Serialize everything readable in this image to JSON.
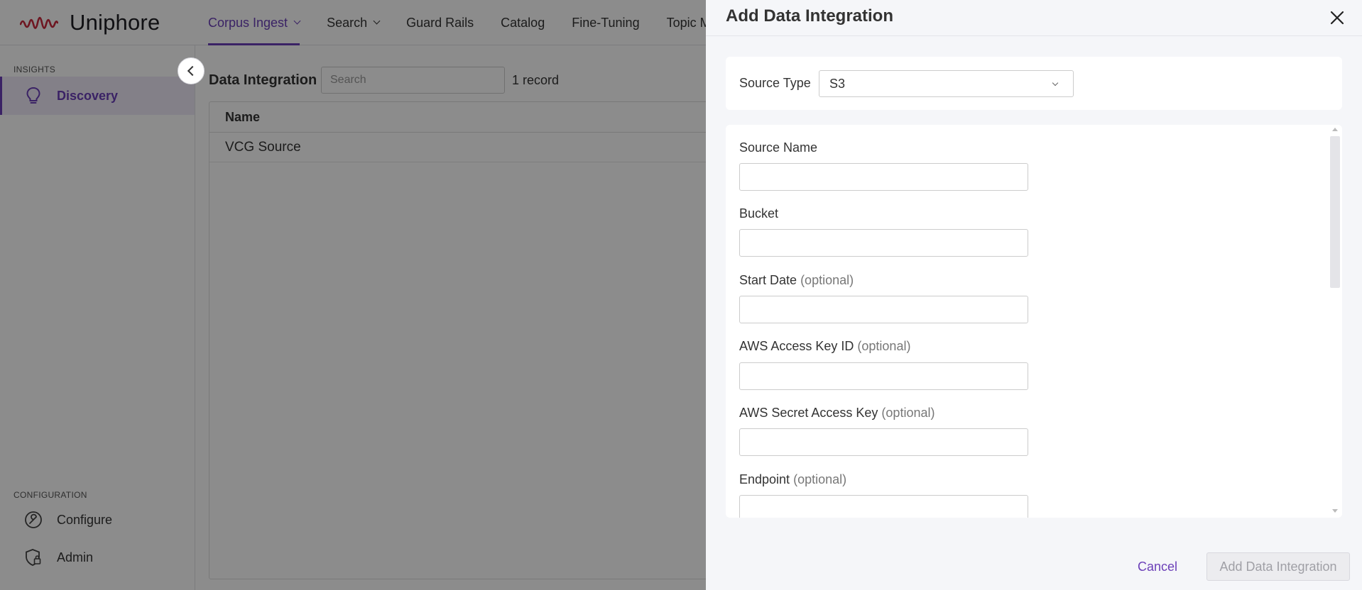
{
  "app": {
    "name": "Uniphore"
  },
  "nav": {
    "items": [
      {
        "label": "Corpus Ingest"
      },
      {
        "label": "Search"
      },
      {
        "label": "Guard Rails"
      },
      {
        "label": "Catalog"
      },
      {
        "label": "Fine-Tuning"
      },
      {
        "label": "Topic M"
      }
    ],
    "active_label": "Corpus Ingest"
  },
  "sidebar": {
    "sections": [
      {
        "label": "INSIGHTS"
      },
      {
        "label": "CONFIGURATION"
      }
    ],
    "items": [
      {
        "label": "Discovery",
        "icon": "lightbulb-icon",
        "active": true
      },
      {
        "label": "Configure",
        "icon": "wrench-icon"
      },
      {
        "label": "Admin",
        "icon": "shield-lock-icon"
      }
    ]
  },
  "main": {
    "title": "Data Integration",
    "search_placeholder": "Search",
    "record_count": "1 record",
    "table": {
      "columns": [
        "Name"
      ],
      "rows": [
        [
          "VCG Source"
        ]
      ]
    }
  },
  "drawer": {
    "title": "Add Data Integration",
    "source_type": {
      "label": "Source Type",
      "value": "S3"
    },
    "fields": [
      {
        "label": "Source Name",
        "optional": ""
      },
      {
        "label": "Bucket",
        "optional": ""
      },
      {
        "label": "Start Date",
        "optional": "(optional)"
      },
      {
        "label": "AWS Access Key ID",
        "optional": "(optional)"
      },
      {
        "label": "AWS Secret Access Key",
        "optional": "(optional)"
      },
      {
        "label": "Endpoint",
        "optional": "(optional)"
      }
    ],
    "cancel_label": "Cancel",
    "submit_label": "Add Data Integration"
  },
  "colors": {
    "accent": "#6b3fb8",
    "logo": "#c8283c",
    "overlay": "rgba(0,0,0,0.45)",
    "drawer_bg": "#f5f6f9"
  }
}
